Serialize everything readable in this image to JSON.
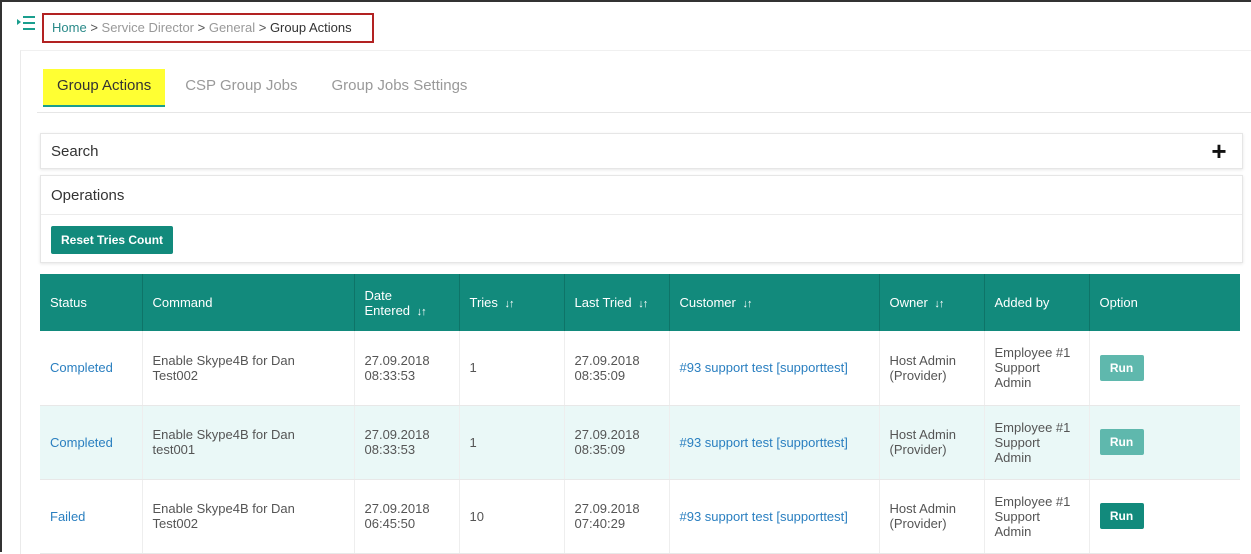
{
  "breadcrumb": {
    "home": "Home",
    "sep": ">",
    "level1": "Service Director",
    "level2": "General",
    "current": "Group Actions"
  },
  "tabs": [
    {
      "label": "Group Actions",
      "active": true
    },
    {
      "label": "CSP Group Jobs",
      "active": false
    },
    {
      "label": "Group Jobs Settings",
      "active": false
    }
  ],
  "search": {
    "title": "Search",
    "expand_icon": "plus-icon"
  },
  "operations": {
    "title": "Operations",
    "reset_label": "Reset Tries Count"
  },
  "table": {
    "headers": {
      "status": "Status",
      "command": "Command",
      "date_entered_1": "Date",
      "date_entered_2": "Entered",
      "tries": "Tries",
      "last_tried": "Last Tried",
      "customer": "Customer",
      "owner": "Owner",
      "added_by": "Added by",
      "option": "Option"
    },
    "sort_glyph": "↓↑",
    "rows": [
      {
        "status": "Completed",
        "command_1": "Enable Skype4B for Dan",
        "command_2": "Test002",
        "date_1": "27.09.2018",
        "date_2": "08:33:53",
        "tries": "1",
        "last_1": "27.09.2018",
        "last_2": "08:35:09",
        "customer": "#93 support test [supporttest]",
        "owner_1": "Host Admin",
        "owner_2": "(Provider)",
        "added_1": "Employee #1",
        "added_2": "Support",
        "added_3": "Admin",
        "run": "Run"
      },
      {
        "status": "Completed",
        "command_1": "Enable Skype4B for Dan",
        "command_2": "test001",
        "date_1": "27.09.2018",
        "date_2": "08:33:53",
        "tries": "1",
        "last_1": "27.09.2018",
        "last_2": "08:35:09",
        "customer": "#93 support test [supporttest]",
        "owner_1": "Host Admin",
        "owner_2": "(Provider)",
        "added_1": "Employee #1",
        "added_2": "Support",
        "added_3": "Admin",
        "run": "Run"
      },
      {
        "status": "Failed",
        "command_1": "Enable Skype4B for Dan",
        "command_2": "Test002",
        "date_1": "27.09.2018",
        "date_2": "06:45:50",
        "tries": "10",
        "last_1": "27.09.2018",
        "last_2": "07:40:29",
        "customer": "#93 support test [supporttest]",
        "owner_1": "Host Admin",
        "owner_2": "(Provider)",
        "added_1": "Employee #1",
        "added_2": "Support",
        "added_3": "Admin",
        "run": "Run"
      }
    ]
  },
  "colors": {
    "accent": "#128a7c",
    "highlight": "#ffff33",
    "link": "#2a7fc0",
    "alt_row": "#eaf8f7",
    "callout_border": "#b22222"
  }
}
